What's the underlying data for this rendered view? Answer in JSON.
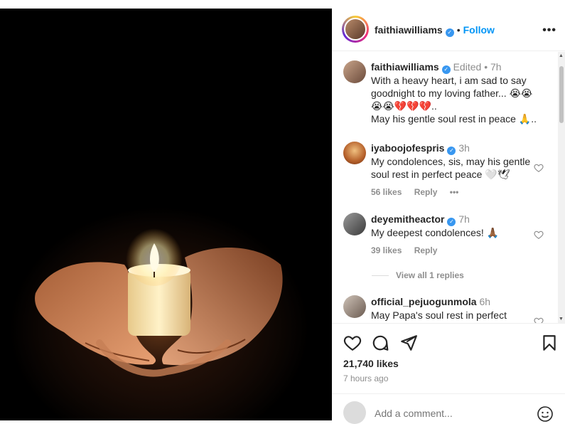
{
  "post": {
    "author": "faithiawilliams",
    "follow_label": "Follow",
    "more_label": "•••"
  },
  "caption": {
    "username": "faithiawilliams",
    "edited": "Edited",
    "time": "7h",
    "text_line1": "With a heavy heart, i am sad to say",
    "text_line2": "goodnight to my loving father... 😭😭",
    "text_line3": "😭😭💔💔💔..",
    "text_line4": "May his gentle soul rest in peace 🙏.."
  },
  "comments": [
    {
      "username": "iyaboojofespris",
      "time": "3h",
      "text": "My condolences, sis, may his gentle soul rest in perfect peace 🤍🕊",
      "likes": "56 likes",
      "reply": "Reply",
      "more": "•••"
    },
    {
      "username": "deyemitheactor",
      "time": "7h",
      "text": "My deepest condolences! 🙏🏾",
      "likes": "39 likes",
      "reply": "Reply",
      "view_replies": "View all 1 replies"
    },
    {
      "username": "official_pejuogunmola",
      "time": "6h",
      "text": "May Papa's soul rest in perfect"
    }
  ],
  "engagement": {
    "likes": "21,740 likes",
    "time_ago": "7 hours ago"
  },
  "composer": {
    "placeholder": "Add a comment..."
  },
  "colors": {
    "link_blue": "#0095f6",
    "verified_blue": "#3897f0",
    "muted_gray": "#8e8e8e"
  }
}
